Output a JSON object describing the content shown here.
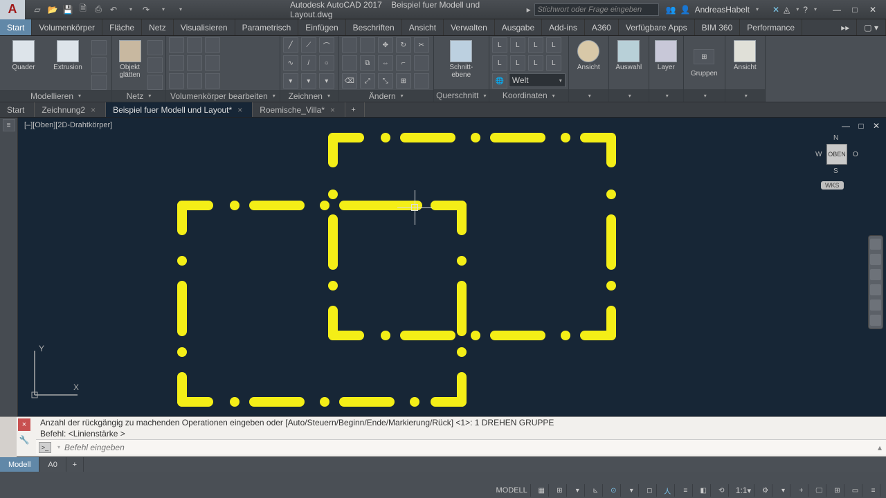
{
  "title_bar": {
    "app": "Autodesk AutoCAD 2017",
    "file": "Beispiel fuer Modell und Layout.dwg",
    "search_placeholder": "Stichwort oder Frage eingeben",
    "user": "AndreasHabelt"
  },
  "menu_tabs": [
    "Start",
    "Volumenkörper",
    "Fläche",
    "Netz",
    "Visualisieren",
    "Parametrisch",
    "Einfügen",
    "Beschriften",
    "Ansicht",
    "Verwalten",
    "Ausgabe",
    "Add-ins",
    "A360",
    "Verfügbare Apps",
    "BIM 360",
    "Performance"
  ],
  "menu_active": 0,
  "ribbon": {
    "model": {
      "label": "Modellieren",
      "btns": [
        "Quader",
        "Extrusion"
      ],
      "obj": "Objekt\nglätten"
    },
    "netz": {
      "label": "Netz"
    },
    "vk_bearb": {
      "label": "Volumenkörper bearbeiten"
    },
    "zeichnen": {
      "label": "Zeichnen"
    },
    "aendern": {
      "label": "Ändern"
    },
    "schnitt": {
      "label": "Querschnitt",
      "btn": "Schnitt-\nebene"
    },
    "koord": {
      "label": "Koordinaten",
      "combo": "Welt"
    },
    "ansicht1": {
      "label": "Ansicht"
    },
    "auswahl": {
      "label": "Auswahl"
    },
    "layer": {
      "label": "Layer"
    },
    "gruppen": {
      "label": "Gruppen"
    },
    "ansicht2": {
      "label": "Ansicht"
    }
  },
  "file_tabs": [
    {
      "label": "Start",
      "closable": false
    },
    {
      "label": "Zeichnung2",
      "closable": true
    },
    {
      "label": "Beispiel fuer Modell und Layout*",
      "closable": true,
      "active": true
    },
    {
      "label": "Roemische_Villa*",
      "closable": true
    }
  ],
  "viewport": {
    "label": "[–][Oben][2D-Drahtkörper]",
    "viewcube_face": "OBEN",
    "viewcube_n": "N",
    "viewcube_s": "S",
    "viewcube_w": "W",
    "viewcube_o": "O",
    "wks": "WKS",
    "ucs_y": "Y",
    "ucs_x": "X"
  },
  "command": {
    "line1": "Anzahl der rückgängig zu machenden Operationen eingeben oder [Auto/Steuern/Beginn/Ende/Markierung/Rück] <1>: 1 DREHEN GRUPPE",
    "line2": "Befehl:  <Linienstärke >",
    "placeholder": "Befehl eingeben"
  },
  "layout_tabs": [
    "Modell",
    "A0"
  ],
  "layout_active": 0,
  "status": {
    "model": "MODELL",
    "scale": "1:1"
  }
}
